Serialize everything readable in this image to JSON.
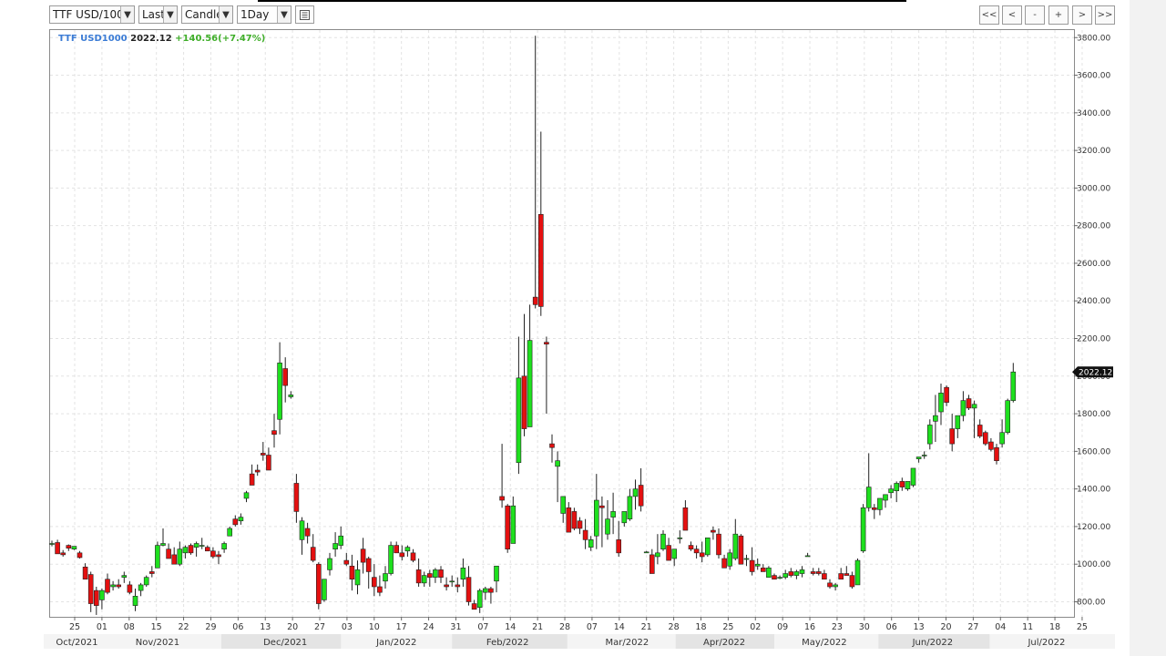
{
  "toolbar": {
    "symbol_value": "TTF USD/100",
    "price_type_value": "Last",
    "chart_type_value": "Candle",
    "period_value": "1Day",
    "dropdown_glyph": "▼",
    "indicator_icon": "list-icon",
    "nav": {
      "first": "<<",
      "prev": "<",
      "zoom_out": "-",
      "zoom_in": "+",
      "next": ">",
      "last": ">>"
    }
  },
  "legend": {
    "symbol": "TTF USD1000",
    "last": "2022.12",
    "change": "+140.56(+7.47%)"
  },
  "colors": {
    "up": "#1ee01e",
    "down": "#e41010",
    "grid": "#e3e3e3",
    "last_badge": "#111111"
  },
  "chart_data": {
    "type": "candlestick",
    "ylim": [
      720,
      3840
    ],
    "y_ticks": [
      800,
      1000,
      1200,
      1400,
      1600,
      1800,
      2000,
      2200,
      2400,
      2600,
      2800,
      3000,
      3200,
      3400,
      3600,
      3800
    ],
    "y_tick_labels": [
      "800.00",
      "1000.00",
      "1200.00",
      "1400.00",
      "1600.00",
      "1800.00",
      "2000.00",
      "2200.00",
      "2400.00",
      "2600.00",
      "2800.00",
      "3000.00",
      "3200.00",
      "3400.00",
      "3600.00",
      "3800.00"
    ],
    "last_price_label": "2022.12",
    "last_price": 2022.12,
    "x_tick_labels": [
      "25",
      "01",
      "08",
      "15",
      "22",
      "29",
      "06",
      "13",
      "20",
      "27",
      "03",
      "10",
      "17",
      "24",
      "31",
      "07",
      "14",
      "21",
      "28",
      "07",
      "14",
      "21",
      "28",
      "18",
      "25",
      "02",
      "09",
      "16",
      "23",
      "30",
      "06",
      "13",
      "20",
      "27",
      "04",
      "11",
      "18",
      "25"
    ],
    "x_tick_positions": [
      4.1,
      9.0,
      13.9,
      18.8,
      23.7,
      28.6,
      33.5,
      38.4,
      43.3,
      48.2,
      53.1,
      58.0,
      62.9,
      67.8,
      72.7,
      77.6,
      82.5,
      87.4,
      92.3,
      97.2,
      102.1,
      107.0,
      111.9,
      116.8,
      121.7,
      126.6,
      131.5,
      136.4,
      141.3,
      146.2,
      151.1,
      156.0,
      160.9,
      165.8,
      170.7,
      175.6,
      180.5,
      185.4
    ],
    "month_labels": [
      "Oct/2021",
      "Nov/2021",
      "Dec/2021",
      "Jan/2022",
      "Feb/2022",
      "Mar/2022",
      "Apr/2022",
      "May/2022",
      "Jun/2022",
      "Jul/2022"
    ],
    "month_positions": [
      4.5,
      19,
      42,
      62,
      82,
      103.5,
      121,
      139,
      158.5,
      179
    ],
    "month_shaded": [
      false,
      false,
      true,
      false,
      true,
      false,
      true,
      false,
      true,
      false
    ],
    "candles": [
      [
        1105,
        1125,
        1095,
        1110
      ],
      [
        1115,
        1130,
        1060,
        1055
      ],
      [
        1060,
        1075,
        1040,
        1050
      ],
      [
        1100,
        1105,
        1070,
        1085
      ],
      [
        1080,
        1095,
        1075,
        1095
      ],
      [
        1060,
        1070,
        1030,
        1035
      ],
      [
        985,
        1005,
        930,
        920
      ],
      [
        945,
        960,
        745,
        790
      ],
      [
        860,
        880,
        730,
        780
      ],
      [
        810,
        870,
        760,
        860
      ],
      [
        920,
        950,
        840,
        850
      ],
      [
        880,
        910,
        860,
        890
      ],
      [
        890,
        920,
        870,
        880
      ],
      [
        930,
        960,
        900,
        940
      ],
      [
        890,
        910,
        840,
        850
      ],
      [
        780,
        870,
        750,
        830
      ],
      [
        860,
        900,
        830,
        890
      ],
      [
        890,
        940,
        880,
        930
      ],
      [
        960,
        990,
        930,
        950
      ],
      [
        980,
        1120,
        990,
        1100
      ],
      [
        1100,
        1190,
        1095,
        1110
      ],
      [
        1080,
        1110,
        1030,
        1030
      ],
      [
        1050,
        1090,
        1000,
        1000
      ],
      [
        1000,
        1120,
        990,
        1080
      ],
      [
        1060,
        1100,
        1030,
        1090
      ],
      [
        1100,
        1110,
        1050,
        1060
      ],
      [
        1090,
        1120,
        1040,
        1110
      ],
      [
        1100,
        1140,
        1080,
        1100
      ],
      [
        1090,
        1100,
        1070,
        1070
      ],
      [
        1070,
        1090,
        1030,
        1040
      ],
      [
        1050,
        1070,
        1000,
        1040
      ],
      [
        1080,
        1120,
        1060,
        1110
      ],
      [
        1150,
        1200,
        1170,
        1190
      ],
      [
        1240,
        1260,
        1200,
        1210
      ],
      [
        1230,
        1270,
        1210,
        1250
      ],
      [
        1350,
        1390,
        1330,
        1380
      ],
      [
        1480,
        1530,
        1420,
        1420
      ],
      [
        1500,
        1530,
        1470,
        1490
      ],
      [
        1590,
        1650,
        1550,
        1580
      ],
      [
        1580,
        1620,
        1510,
        1500
      ],
      [
        1710,
        1800,
        1620,
        1690
      ],
      [
        1770,
        2180,
        1690,
        2070
      ],
      [
        2040,
        2100,
        1860,
        1950
      ],
      [
        1890,
        1920,
        1880,
        1900
      ],
      [
        1430,
        1480,
        1220,
        1280
      ],
      [
        1130,
        1250,
        1050,
        1230
      ],
      [
        1190,
        1220,
        1110,
        1150
      ],
      [
        1090,
        1160,
        1010,
        1020
      ],
      [
        1000,
        1010,
        760,
        790
      ],
      [
        810,
        920,
        800,
        920
      ],
      [
        970,
        1060,
        940,
        1030
      ],
      [
        1080,
        1170,
        1040,
        1110
      ],
      [
        1100,
        1200,
        1080,
        1150
      ],
      [
        1020,
        1060,
        990,
        1000
      ],
      [
        990,
        1050,
        860,
        920
      ],
      [
        890,
        1020,
        840,
        970
      ],
      [
        1080,
        1140,
        950,
        1010
      ],
      [
        1030,
        1040,
        870,
        960
      ],
      [
        930,
        1000,
        830,
        880
      ],
      [
        880,
        940,
        830,
        850
      ],
      [
        910,
        990,
        870,
        950
      ],
      [
        950,
        1120,
        940,
        1100
      ],
      [
        1100,
        1120,
        1080,
        1060
      ],
      [
        1060,
        1100,
        1020,
        1040
      ],
      [
        1070,
        1100,
        1040,
        1090
      ],
      [
        1060,
        1080,
        1010,
        1020
      ],
      [
        970,
        1030,
        880,
        900
      ],
      [
        900,
        960,
        880,
        940
      ],
      [
        950,
        970,
        880,
        930
      ],
      [
        930,
        980,
        900,
        970
      ],
      [
        970,
        990,
        900,
        930
      ],
      [
        890,
        930,
        860,
        880
      ],
      [
        910,
        940,
        880,
        910
      ],
      [
        890,
        930,
        850,
        880
      ],
      [
        920,
        1030,
        880,
        980
      ],
      [
        930,
        990,
        780,
        800
      ],
      [
        790,
        810,
        760,
        760
      ],
      [
        770,
        870,
        740,
        860
      ],
      [
        850,
        880,
        810,
        870
      ],
      [
        870,
        880,
        790,
        850
      ],
      [
        910,
        990,
        850,
        990
      ],
      [
        1360,
        1640,
        1300,
        1340
      ],
      [
        1310,
        1320,
        1060,
        1080
      ],
      [
        1110,
        1360,
        1130,
        1310
      ],
      [
        1540,
        2210,
        1480,
        1990
      ],
      [
        2000,
        2330,
        1680,
        1720
      ],
      [
        1730,
        2380,
        1770,
        2190
      ],
      [
        2420,
        3810,
        2360,
        2380
      ],
      [
        2860,
        3300,
        2320,
        2370
      ],
      [
        2180,
        2210,
        1800,
        2170
      ],
      [
        1640,
        1690,
        1540,
        1620
      ],
      [
        1520,
        1600,
        1330,
        1550
      ],
      [
        1270,
        1360,
        1220,
        1360
      ],
      [
        1300,
        1330,
        1220,
        1170
      ],
      [
        1280,
        1300,
        1180,
        1190
      ],
      [
        1230,
        1250,
        1160,
        1190
      ],
      [
        1180,
        1240,
        1080,
        1130
      ],
      [
        1090,
        1150,
        1070,
        1130
      ],
      [
        1150,
        1480,
        1080,
        1340
      ],
      [
        1310,
        1360,
        1090,
        1300
      ],
      [
        1160,
        1340,
        1130,
        1240
      ],
      [
        1250,
        1380,
        1160,
        1280
      ],
      [
        1130,
        1230,
        1040,
        1060
      ],
      [
        1220,
        1270,
        1200,
        1280
      ],
      [
        1240,
        1400,
        1230,
        1360
      ],
      [
        1360,
        1450,
        1290,
        1400
      ],
      [
        1420,
        1510,
        1280,
        1310
      ],
      [
        1060,
        1070,
        1060,
        1065
      ],
      [
        1050,
        1080,
        950,
        950
      ],
      [
        1040,
        1160,
        1000,
        1060
      ],
      [
        1080,
        1180,
        1070,
        1160
      ],
      [
        1100,
        1140,
        1020,
        1020
      ],
      [
        1030,
        1080,
        990,
        1080
      ],
      [
        1140,
        1180,
        1110,
        1140
      ],
      [
        1300,
        1340,
        1190,
        1180
      ],
      [
        1100,
        1120,
        1070,
        1080
      ],
      [
        1080,
        1100,
        1030,
        1060
      ],
      [
        1060,
        1120,
        1010,
        1040
      ],
      [
        1050,
        1140,
        1040,
        1140
      ],
      [
        1180,
        1200,
        1130,
        1170
      ],
      [
        1160,
        1190,
        1030,
        1050
      ],
      [
        1030,
        1050,
        980,
        980
      ],
      [
        990,
        1080,
        970,
        1060
      ],
      [
        1030,
        1240,
        1020,
        1160
      ],
      [
        1150,
        1160,
        1000,
        1000
      ],
      [
        1030,
        1050,
        990,
        1030
      ],
      [
        1020,
        1090,
        940,
        960
      ],
      [
        990,
        1030,
        970,
        1000
      ],
      [
        980,
        1000,
        960,
        960
      ],
      [
        930,
        990,
        940,
        980
      ],
      [
        940,
        950,
        920,
        920
      ],
      [
        925,
        940,
        920,
        930
      ],
      [
        930,
        970,
        920,
        950
      ],
      [
        960,
        980,
        930,
        940
      ],
      [
        940,
        970,
        920,
        960
      ],
      [
        950,
        990,
        930,
        970
      ],
      [
        1040,
        1060,
        1040,
        1045
      ],
      [
        960,
        980,
        940,
        950
      ],
      [
        960,
        980,
        940,
        950
      ],
      [
        950,
        970,
        930,
        920
      ],
      [
        900,
        920,
        870,
        880
      ],
      [
        880,
        900,
        860,
        890
      ],
      [
        950,
        980,
        930,
        920
      ],
      [
        950,
        990,
        940,
        940
      ],
      [
        940,
        960,
        870,
        880
      ],
      [
        890,
        1030,
        890,
        1020
      ],
      [
        1070,
        1320,
        1060,
        1300
      ],
      [
        1300,
        1590,
        1280,
        1410
      ],
      [
        1300,
        1320,
        1240,
        1290
      ],
      [
        1290,
        1350,
        1260,
        1350
      ],
      [
        1340,
        1370,
        1300,
        1370
      ],
      [
        1380,
        1420,
        1350,
        1400
      ],
      [
        1390,
        1440,
        1330,
        1430
      ],
      [
        1440,
        1460,
        1390,
        1410
      ],
      [
        1400,
        1440,
        1390,
        1440
      ],
      [
        1420,
        1500,
        1410,
        1510
      ],
      [
        1560,
        1570,
        1540,
        1570
      ],
      [
        1580,
        1600,
        1560,
        1580
      ],
      [
        1640,
        1770,
        1610,
        1740
      ],
      [
        1760,
        1900,
        1650,
        1790
      ],
      [
        1810,
        1960,
        1740,
        1910
      ],
      [
        1940,
        1950,
        1840,
        1860
      ],
      [
        1720,
        1800,
        1600,
        1640
      ],
      [
        1720,
        1780,
        1670,
        1790
      ],
      [
        1790,
        1920,
        1760,
        1870
      ],
      [
        1880,
        1900,
        1820,
        1830
      ],
      [
        1830,
        1870,
        1670,
        1850
      ],
      [
        1740,
        1770,
        1670,
        1680
      ],
      [
        1700,
        1710,
        1630,
        1640
      ],
      [
        1650,
        1670,
        1600,
        1610
      ],
      [
        1620,
        1640,
        1530,
        1550
      ],
      [
        1640,
        1770,
        1620,
        1700
      ],
      [
        1700,
        1880,
        1690,
        1870
      ],
      [
        1870,
        2070,
        1860,
        2022.12
      ]
    ]
  }
}
